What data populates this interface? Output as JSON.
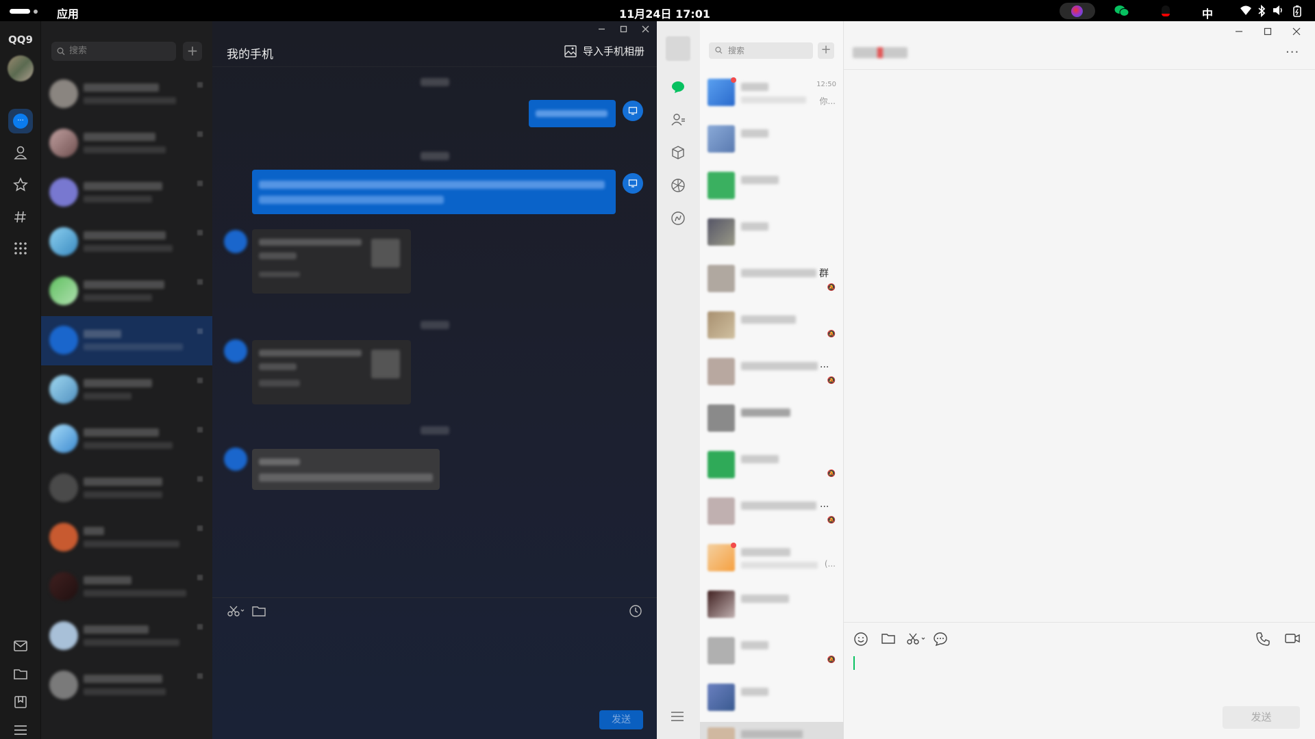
{
  "topbar": {
    "apps_label": "应用",
    "clock": "11月24日 17:01",
    "ime": "中",
    "tray_icons": [
      "qq9-tray-icon",
      "wechat-tray-icon",
      "qq-penguin-tray-icon",
      "wifi-icon",
      "bluetooth-icon",
      "volume-icon",
      "battery-icon"
    ]
  },
  "qq": {
    "logo": "QQ9",
    "search_placeholder": "搜索",
    "add_label": "+",
    "chat_title": "我的手机",
    "import_album_label": "导入手机相册",
    "send_label": "发送",
    "nav_top": [
      "message-icon",
      "contacts-icon",
      "favorites-icon",
      "channels-icon",
      "more-apps-icon"
    ],
    "nav_bottom": [
      "mail-icon",
      "folder-icon",
      "bookmark-icon",
      "menu-icon"
    ],
    "accent_color": "#0a63c9"
  },
  "wechat": {
    "search_placeholder": "搜索",
    "add_label": "+",
    "first_chat_time": "12:50",
    "first_chat_preview_tail": "你...",
    "row5_suffix": "群",
    "row7_suffix": "...",
    "row10_suffix": "...",
    "row11_preview_tail": "(...",
    "send_label": "发送",
    "more_label": "···",
    "accent_color": "#07c160"
  }
}
